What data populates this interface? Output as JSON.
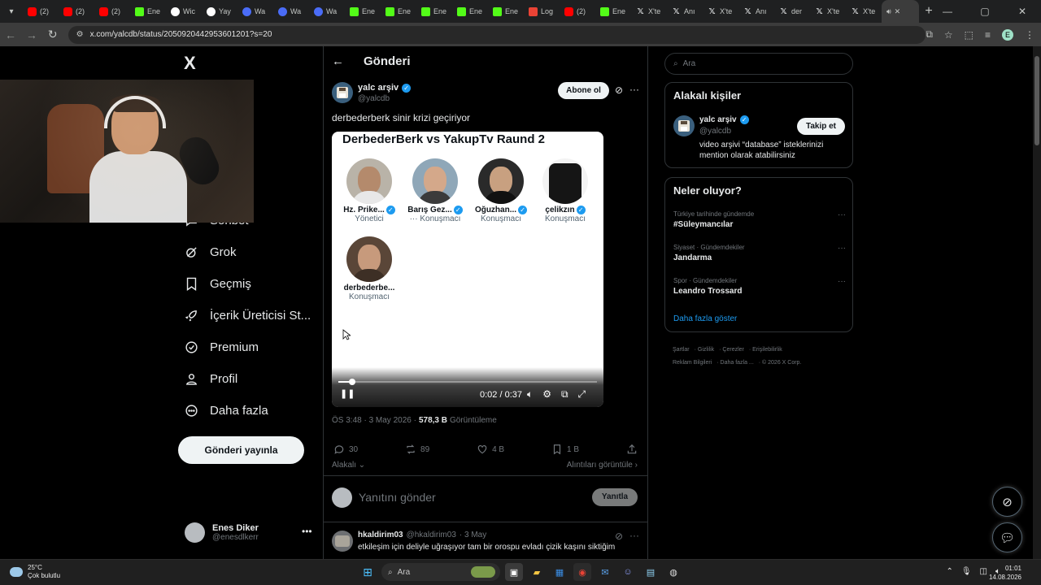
{
  "browser": {
    "tabs": [
      {
        "label": "(2)",
        "icon": "youtube-icon"
      },
      {
        "label": "(2)",
        "icon": "youtube-icon"
      },
      {
        "label": "(2)",
        "icon": "youtube-icon"
      },
      {
        "label": "Ene",
        "icon": "kick-icon"
      },
      {
        "label": "Wic",
        "icon": "wiki-icon"
      },
      {
        "label": "Yay",
        "icon": "wiki-icon"
      },
      {
        "label": "Wa",
        "icon": "site-icon"
      },
      {
        "label": "Wa",
        "icon": "site-icon"
      },
      {
        "label": "Wa",
        "icon": "site-icon"
      },
      {
        "label": "Ene",
        "icon": "kick-icon"
      },
      {
        "label": "Ene",
        "icon": "kick-icon"
      },
      {
        "label": "Ene",
        "icon": "kick-icon"
      },
      {
        "label": "Ene",
        "icon": "kick-icon"
      },
      {
        "label": "Ene",
        "icon": "kick-icon"
      },
      {
        "label": "Log",
        "icon": "gmail-icon"
      },
      {
        "label": "(2)",
        "icon": "youtube-icon"
      },
      {
        "label": "Ene",
        "icon": "kick-icon"
      },
      {
        "label": "X'te",
        "icon": "x-icon"
      },
      {
        "label": "Anı",
        "icon": "x-icon"
      },
      {
        "label": "X'te",
        "icon": "x-icon"
      },
      {
        "label": "Anı",
        "icon": "x-icon"
      },
      {
        "label": "der",
        "icon": "x-icon"
      },
      {
        "label": "X'te",
        "icon": "x-icon"
      },
      {
        "label": "X'te",
        "icon": "x-icon"
      }
    ],
    "url": "x.com/yalcdb/status/2050920442953601201?s=20"
  },
  "nav": {
    "logo": "X",
    "items": [
      {
        "label": "Sohbet",
        "icon": "chat-icon"
      },
      {
        "label": "Grok",
        "icon": "grok-icon"
      },
      {
        "label": "Geçmiş",
        "icon": "bookmark-icon"
      },
      {
        "label": "İçerik Üreticisi St...",
        "icon": "rocket-icon"
      },
      {
        "label": "Premium",
        "icon": "verified-icon"
      },
      {
        "label": "Profil",
        "icon": "person-icon"
      },
      {
        "label": "Daha fazla",
        "icon": "more-circle-icon"
      }
    ],
    "post_button": "Gönderi yayınla",
    "user": {
      "name": "Enes Diker",
      "handle": "@enesdlkerr"
    }
  },
  "post": {
    "header_title": "Gönderi",
    "author": {
      "name": "yalc arşiv",
      "handle": "@yalcdb"
    },
    "subscribe": "Abone ol",
    "text": "derbederberk sinir krizi geçiriyor",
    "video": {
      "title": "DerbederBerk vs YakupTv Raund 2",
      "speakers": [
        {
          "name": "Hz. Prike...",
          "role": "Yönetici"
        },
        {
          "name": "Barış Gez...",
          "role": "Konuşmacı"
        },
        {
          "name": "Oğuzhan...",
          "role": "Konuşmacı"
        },
        {
          "name": "çelikzın",
          "role": "Konuşmacı"
        },
        {
          "name": "derbederbe...",
          "role": "Konuşmacı"
        }
      ],
      "time": "0:02 / 0:37",
      "progress": 0.054
    },
    "timestamp": "ÖS 3:48 · 3 May 2026 ·",
    "views": "578,3 B",
    "views_label": "Görüntüleme",
    "stats": {
      "replies": "30",
      "reposts": "89",
      "likes": "4 B",
      "bookmarks": "1 B"
    },
    "related_left": "Alakalı",
    "related_right": "Alıntıları görüntüle",
    "reply_placeholder": "Yanıtını gönder",
    "reply_button": "Yanıtla"
  },
  "comment": {
    "name": "hkaldirim03",
    "handle": "@hkaldirim03",
    "date": "· 3 May",
    "text": "etkileşim için deliyle uğraşıyor tam bir orospu evladı çizik kaşını siktiğim"
  },
  "sidebar": {
    "search_placeholder": "Ara",
    "related_title": "Alakalı kişiler",
    "related_person": {
      "name": "yalc arşiv",
      "handle": "@yalcdb",
      "follow": "Takip et",
      "bio": "video arşivi “database” isteklerinizi mention olarak atabilirsiniz"
    },
    "trends_title": "Neler oluyor?",
    "trends": [
      {
        "context": "Türkiye tarihinde gündemde",
        "name": "#Süleymancılar"
      },
      {
        "context": "Siyaset · Gündemdekiler",
        "name": "Jandarma"
      },
      {
        "context": "Spor · Gündemdekiler",
        "name": "Leandro Trossard"
      }
    ],
    "show_more": "Daha fazla göster",
    "footer_line1": [
      "Şartlar",
      "Gizlilik",
      "Çerezler",
      "Erişilebilirlik"
    ],
    "footer_line2": [
      "Reklam Bilgileri",
      "Daha fazla ...",
      "© 2026 X Corp."
    ]
  },
  "taskbar": {
    "temp": "25°C",
    "weather": "Çok bulutlu",
    "search": "Ara",
    "time": "01:01",
    "date": "14.08.2026"
  },
  "colors": {
    "accent": "#1d9bf0",
    "border": "#2f3336",
    "muted": "#71767b"
  }
}
